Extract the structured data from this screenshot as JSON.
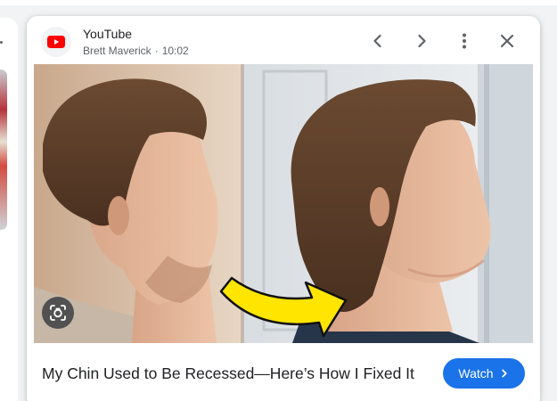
{
  "source": {
    "site_name": "YouTube",
    "author": "Brett Maverick",
    "separator": "·",
    "duration": "10:02"
  },
  "controls": {
    "previous_icon": "chevron-left-icon",
    "next_icon": "chevron-right-icon",
    "more_icon": "more-vert-icon",
    "close_icon": "close-icon",
    "lens_icon": "google-lens-icon"
  },
  "video": {
    "title": "My Chin Used to Be Recessed—Here’s How I Fixed It",
    "watch_label": "Watch"
  },
  "colors": {
    "accent": "#1a73e8",
    "youtube_red": "#ff0000",
    "arrow_yellow": "#ffe500"
  }
}
